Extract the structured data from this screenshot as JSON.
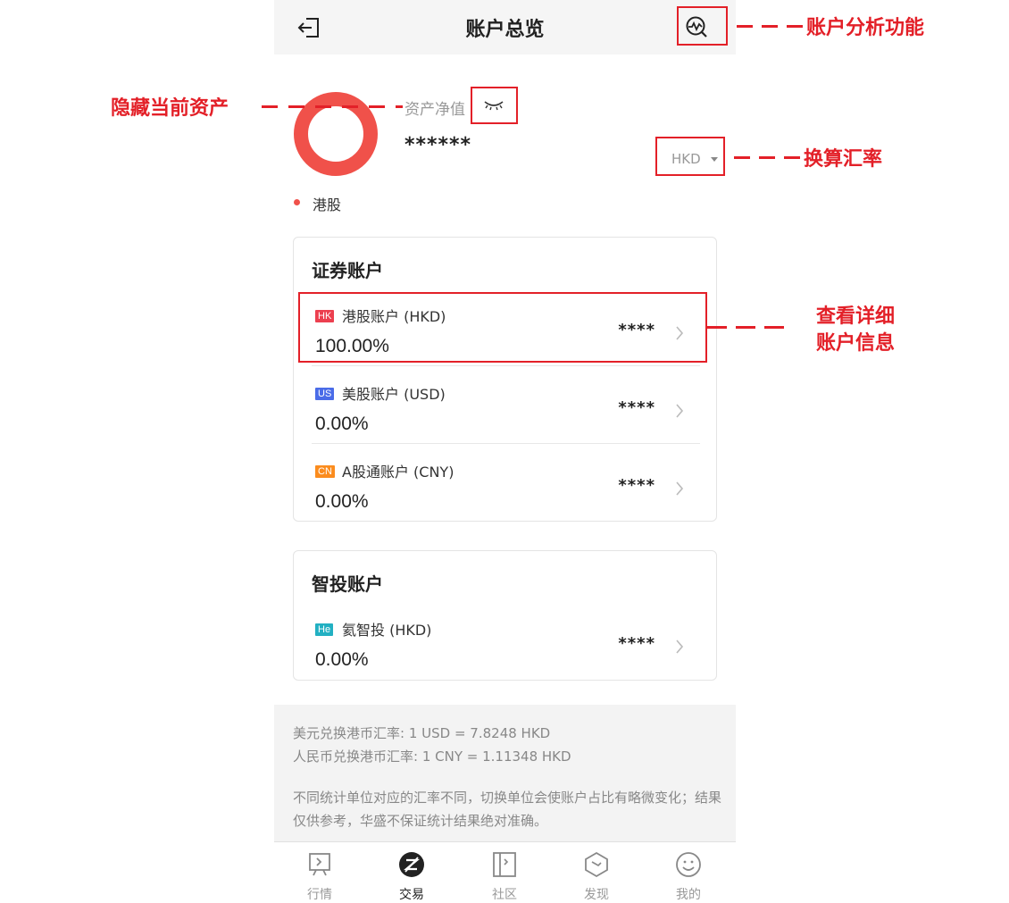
{
  "nav": {
    "title": "账户总览"
  },
  "overview": {
    "net_label": "资产净值",
    "net_value": "******",
    "currency": "HKD",
    "legend_label": "港股"
  },
  "colors": {
    "donut": "#f0514a",
    "annotation": "#e32028",
    "badge_hk": "#ec3f4f",
    "badge_us": "#4a6ce8",
    "badge_cn": "#fb8c1e",
    "badge_he": "#22b0c2"
  },
  "securities": {
    "title": "证券账户",
    "accounts": [
      {
        "badge": "HK",
        "name": "港股账户 (HKD)",
        "pct": "100.00%",
        "mask": "****"
      },
      {
        "badge": "US",
        "name": "美股账户 (USD)",
        "pct": "0.00%",
        "mask": "****"
      },
      {
        "badge": "CN",
        "name": "A股通账户 (CNY)",
        "pct": "0.00%",
        "mask": "****"
      }
    ]
  },
  "smart": {
    "title": "智投账户",
    "accounts": [
      {
        "badge": "He",
        "name": "氦智投 (HKD)",
        "pct": "0.00%",
        "mask": "****"
      }
    ]
  },
  "footer": {
    "rate_usd": "美元兑换港币汇率: 1 USD = 7.8248 HKD",
    "rate_cny": "人民币兑换港币汇率: 1 CNY = 1.11348 HKD",
    "disclaimer": "不同统计单位对应的汇率不同，切换单位会使账户占比有略微变化；结果仅供参考，华盛不保证统计结果绝对准确。"
  },
  "tabs": [
    {
      "label": "行情",
      "icon": "market-icon"
    },
    {
      "label": "交易",
      "icon": "trade-icon"
    },
    {
      "label": "社区",
      "icon": "community-icon"
    },
    {
      "label": "发现",
      "icon": "discover-icon"
    },
    {
      "label": "我的",
      "icon": "profile-icon"
    }
  ],
  "annotations": {
    "analysis": "账户分析功能",
    "hide": "隐藏当前资产",
    "exchange": "换算汇率",
    "detail_line1": "查看详细",
    "detail_line2": "账户信息"
  }
}
